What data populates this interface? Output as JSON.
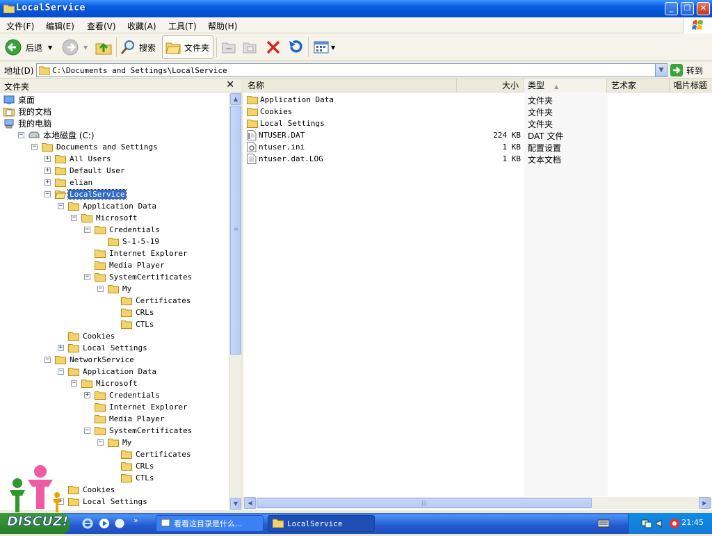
{
  "window": {
    "title": "LocalService"
  },
  "menu": [
    "文件(F)",
    "编辑(E)",
    "查看(V)",
    "收藏(A)",
    "工具(T)",
    "帮助(H)"
  ],
  "toolbar": {
    "back": "后退",
    "search": "搜索",
    "folders": "文件夹"
  },
  "address": {
    "label": "地址(D)",
    "value": "C:\\Documents and Settings\\LocalService",
    "go": "转到"
  },
  "folder_pane": {
    "title": "文件夹"
  },
  "tree": [
    {
      "label": "桌面",
      "depth": 0,
      "expander": "",
      "icon": "desktop-icon",
      "selected": false
    },
    {
      "label": "我的文档",
      "depth": 0,
      "expander": "+",
      "icon": "my-documents-icon",
      "selected": false
    },
    {
      "label": "我的电脑",
      "depth": 0,
      "expander": "-",
      "icon": "my-computer-icon",
      "selected": false
    },
    {
      "label": "本地磁盘 (C:)",
      "depth": 1,
      "expander": "-",
      "icon": "drive-icon",
      "selected": false
    },
    {
      "label": "Documents and Settings",
      "depth": 2,
      "expander": "-",
      "icon": "folder-icon",
      "selected": false
    },
    {
      "label": "All Users",
      "depth": 3,
      "expander": "+",
      "icon": "folder-icon",
      "selected": false
    },
    {
      "label": "Default User",
      "depth": 3,
      "expander": "+",
      "icon": "folder-icon",
      "selected": false
    },
    {
      "label": "elian",
      "depth": 3,
      "expander": "+",
      "icon": "folder-icon",
      "selected": false
    },
    {
      "label": "LocalService",
      "depth": 3,
      "expander": "-",
      "icon": "folder-open-icon",
      "selected": true
    },
    {
      "label": "Application Data",
      "depth": 4,
      "expander": "-",
      "icon": "folder-icon",
      "selected": false
    },
    {
      "label": "Microsoft",
      "depth": 5,
      "expander": "-",
      "icon": "folder-icon",
      "selected": false
    },
    {
      "label": "Credentials",
      "depth": 6,
      "expander": "-",
      "icon": "folder-icon",
      "selected": false
    },
    {
      "label": "S-1-5-19",
      "depth": 7,
      "expander": "",
      "icon": "folder-icon",
      "selected": false
    },
    {
      "label": "Internet Explorer",
      "depth": 6,
      "expander": "",
      "icon": "folder-icon",
      "selected": false
    },
    {
      "label": "Media Player",
      "depth": 6,
      "expander": "",
      "icon": "folder-icon",
      "selected": false
    },
    {
      "label": "SystemCertificates",
      "depth": 6,
      "expander": "-",
      "icon": "folder-icon",
      "selected": false
    },
    {
      "label": "My",
      "depth": 7,
      "expander": "-",
      "icon": "folder-icon",
      "selected": false
    },
    {
      "label": "Certificates",
      "depth": 8,
      "expander": "",
      "icon": "folder-icon",
      "selected": false
    },
    {
      "label": "CRLs",
      "depth": 8,
      "expander": "",
      "icon": "folder-icon",
      "selected": false
    },
    {
      "label": "CTLs",
      "depth": 8,
      "expander": "",
      "icon": "folder-icon",
      "selected": false
    },
    {
      "label": "Cookies",
      "depth": 4,
      "expander": "",
      "icon": "folder-icon",
      "selected": false
    },
    {
      "label": "Local Settings",
      "depth": 4,
      "expander": "+",
      "icon": "folder-icon",
      "selected": false
    },
    {
      "label": "NetworkService",
      "depth": 3,
      "expander": "-",
      "icon": "folder-icon",
      "selected": false
    },
    {
      "label": "Application Data",
      "depth": 4,
      "expander": "-",
      "icon": "folder-icon",
      "selected": false
    },
    {
      "label": "Microsoft",
      "depth": 5,
      "expander": "-",
      "icon": "folder-icon",
      "selected": false
    },
    {
      "label": "Credentials",
      "depth": 6,
      "expander": "+",
      "icon": "folder-icon",
      "selected": false
    },
    {
      "label": "Internet Explorer",
      "depth": 6,
      "expander": "",
      "icon": "folder-icon",
      "selected": false
    },
    {
      "label": "Media Player",
      "depth": 6,
      "expander": "",
      "icon": "folder-icon",
      "selected": false
    },
    {
      "label": "SystemCertificates",
      "depth": 6,
      "expander": "-",
      "icon": "folder-icon",
      "selected": false
    },
    {
      "label": "My",
      "depth": 7,
      "expander": "-",
      "icon": "folder-icon",
      "selected": false
    },
    {
      "label": "Certificates",
      "depth": 8,
      "expander": "",
      "icon": "folder-icon",
      "selected": false
    },
    {
      "label": "CRLs",
      "depth": 8,
      "expander": "",
      "icon": "folder-icon",
      "selected": false
    },
    {
      "label": "CTLs",
      "depth": 8,
      "expander": "",
      "icon": "folder-icon",
      "selected": false
    },
    {
      "label": "Cookies",
      "depth": 4,
      "expander": "",
      "icon": "folder-icon",
      "selected": false
    },
    {
      "label": "Local Settings",
      "depth": 4,
      "expander": "+",
      "icon": "folder-icon",
      "selected": false
    }
  ],
  "columns": [
    "名称",
    "大小",
    "类型",
    "艺术家",
    "唱片标题"
  ],
  "files": [
    {
      "name": "Application Data",
      "size": "",
      "type": "文件夹",
      "icon": "folder-icon"
    },
    {
      "name": "Cookies",
      "size": "",
      "type": "文件夹",
      "icon": "folder-icon"
    },
    {
      "name": "Local Settings",
      "size": "",
      "type": "文件夹",
      "icon": "folder-icon"
    },
    {
      "name": "NTUSER.DAT",
      "size": "224 KB",
      "type": "DAT 文件",
      "icon": "dat-file-icon"
    },
    {
      "name": "ntuser.ini",
      "size": "1 KB",
      "type": "配置设置",
      "icon": "ini-file-icon"
    },
    {
      "name": "ntuser.dat.LOG",
      "size": "1 KB",
      "type": "文本文档",
      "icon": "text-file-icon"
    }
  ],
  "taskbar": {
    "tasks": [
      {
        "label": "看看这目录是什么...",
        "active": false
      },
      {
        "label": "LocalService",
        "active": true
      }
    ],
    "clock": "21:45",
    "watermark": "DISCUZ!"
  },
  "colors": {
    "selection": "#316ac5",
    "titlebar": "#0a5fe3",
    "taskbar": "#2459cf"
  }
}
